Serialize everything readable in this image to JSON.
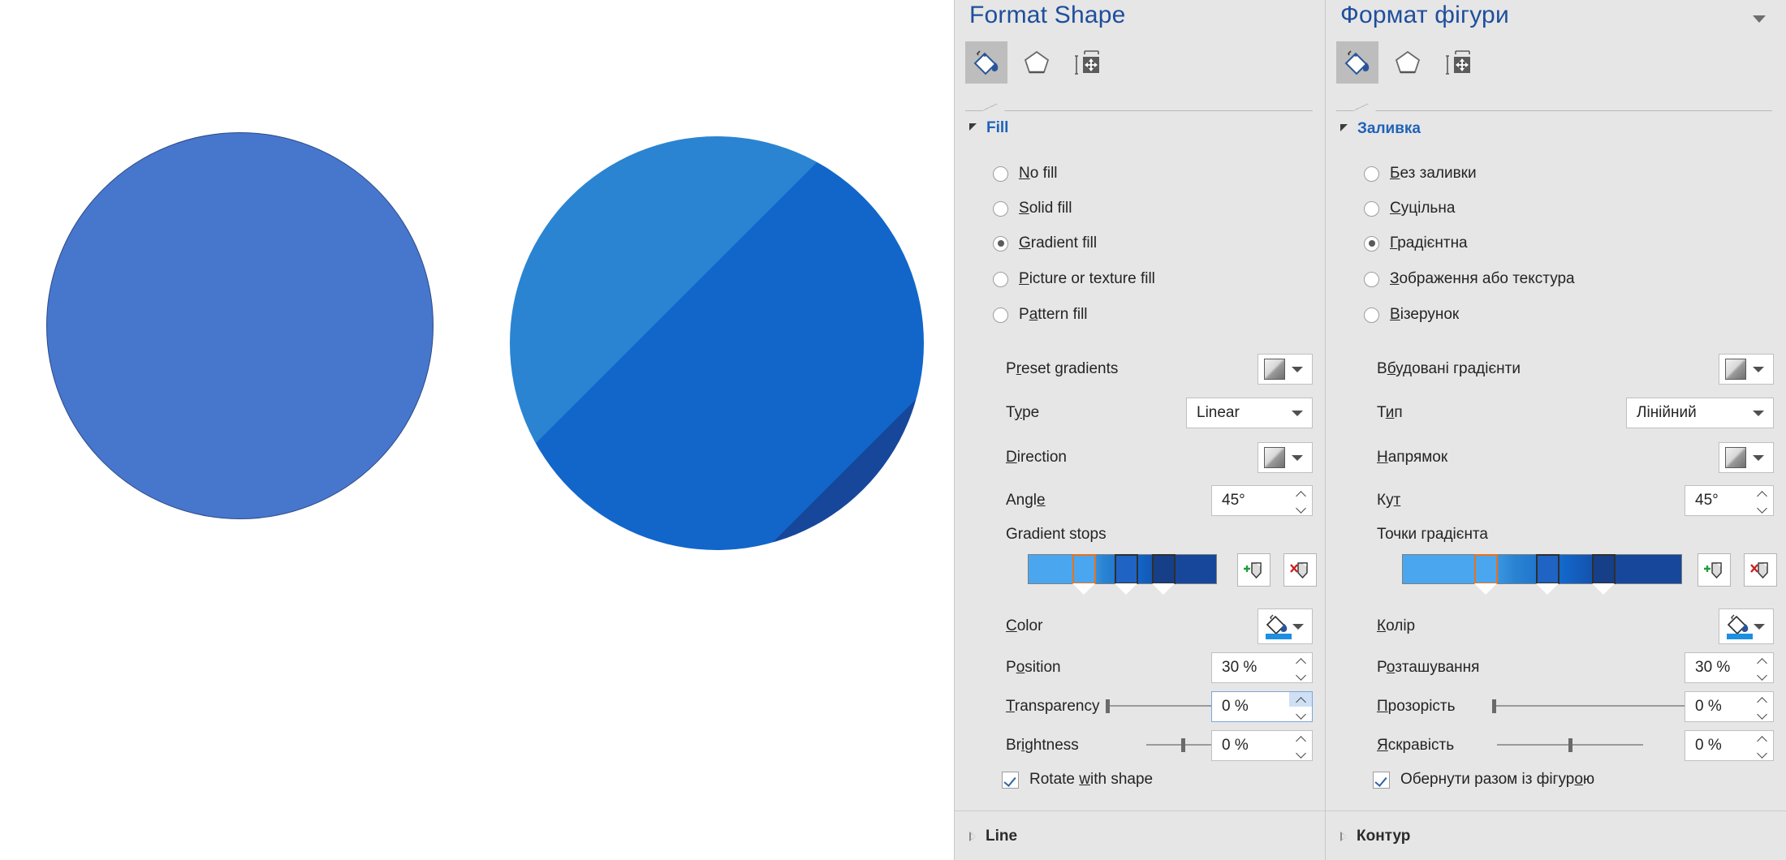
{
  "canvas": {
    "shapes": [
      {
        "name": "solid-blue-circle",
        "fill": "#4776cd",
        "outline": "#2b4a87"
      },
      {
        "name": "gradient-blue-circle",
        "angle": "45",
        "bands": [
          "#4aa7ef",
          "#2a84d2",
          "#1266ca",
          "#16479b"
        ]
      }
    ]
  },
  "panels": [
    {
      "id": "en",
      "title": "Format Shape",
      "tabs": [
        {
          "name": "fill-and-line",
          "icon": "paint-bucket-icon",
          "active": true
        },
        {
          "name": "effects",
          "icon": "pentagon-icon",
          "active": false
        },
        {
          "name": "size-and-properties",
          "icon": "size-properties-icon",
          "active": false
        }
      ],
      "fill_section": {
        "label": "Fill",
        "expanded": true,
        "options": [
          {
            "label": "No fill",
            "acc": "N",
            "rest": "o fill",
            "selected": false
          },
          {
            "label": "Solid fill",
            "acc": "S",
            "rest": "olid fill",
            "selected": false
          },
          {
            "label": "Gradient fill",
            "acc": "G",
            "rest": "radient fill",
            "selected": true
          },
          {
            "label": "Picture or texture fill",
            "acc": "P",
            "rest": "icture or texture fill",
            "selected": false
          },
          {
            "label": "Pattern fill",
            "pre": "P",
            "acc": "a",
            "rest": "ttern fill",
            "selected": false
          }
        ],
        "preset_gradients": {
          "label_pre": "P",
          "label_acc": "r",
          "label_rest": "eset gradients"
        },
        "type": {
          "label_pre": "T",
          "label_acc": "y",
          "label_rest": "pe",
          "value": "Linear"
        },
        "direction": {
          "label_acc": "D",
          "label_rest": "irection"
        },
        "angle": {
          "label_pre": "Angl",
          "label_acc": "e",
          "label_rest": "",
          "value": "45°"
        },
        "gradient_stops": {
          "label": "Gradient stops"
        },
        "add_stop": {
          "name": "add-gradient-stop-button"
        },
        "remove_stop": {
          "name": "remove-gradient-stop-button"
        },
        "color": {
          "label_acc": "C",
          "label_rest": "olor"
        },
        "position": {
          "label_pre": "P",
          "label_acc": "o",
          "label_rest": "sition",
          "value": "30 %"
        },
        "transparency": {
          "label_acc": "T",
          "label_rest": "ransparency",
          "value": "0 %",
          "slider_pct": 0,
          "focused": true
        },
        "brightness": {
          "label_pre": "Br",
          "label_acc": "i",
          "label_rest": "ghtness",
          "value": "0 %",
          "slider_pct": 50
        },
        "rotate_with_shape": {
          "pre": "Rotate ",
          "acc": "w",
          "rest": "ith shape",
          "checked": true
        }
      },
      "line_section": {
        "label": "Line",
        "expanded": false
      }
    },
    {
      "id": "uk",
      "title": "Формат фігури",
      "tabs": [
        {
          "name": "fill-and-line",
          "icon": "paint-bucket-icon",
          "active": true
        },
        {
          "name": "effects",
          "icon": "pentagon-icon",
          "active": false
        },
        {
          "name": "size-and-properties",
          "icon": "size-properties-icon",
          "active": false
        }
      ],
      "fill_section": {
        "label": "Заливка",
        "expanded": true,
        "options": [
          {
            "label": "Без заливки",
            "acc": "Б",
            "rest": "ез заливки",
            "selected": false
          },
          {
            "label": "Суцільна",
            "acc": "С",
            "rest": "уцільна",
            "selected": false
          },
          {
            "label": "Градієнтна",
            "acc": "Г",
            "rest": "радієнтна",
            "selected": true
          },
          {
            "label": "Зображення або текстура",
            "acc": "З",
            "rest": "ображення або текстура",
            "selected": false
          },
          {
            "label": "Візерунок",
            "acc": "В",
            "rest": "ізерунок",
            "selected": false
          }
        ],
        "preset_gradients": {
          "label_pre": "В",
          "label_acc": "б",
          "label_rest": "удовані градієнти"
        },
        "type": {
          "label_pre": "Т",
          "label_acc": "и",
          "label_rest": "п",
          "value": "Лінійний"
        },
        "direction": {
          "label_acc": "Н",
          "label_rest": "апрямок"
        },
        "angle": {
          "label_pre": "Ку",
          "label_acc": "т",
          "label_rest": "",
          "value": "45°"
        },
        "gradient_stops": {
          "label": "Точки градієнта"
        },
        "add_stop": {
          "name": "add-gradient-stop-button"
        },
        "remove_stop": {
          "name": "remove-gradient-stop-button"
        },
        "color": {
          "label_acc": "К",
          "label_rest": "олір"
        },
        "position": {
          "label_pre": "Р",
          "label_acc": "о",
          "label_rest": "зташування",
          "value": "30 %"
        },
        "transparency": {
          "label_acc": "П",
          "label_rest": "розорість",
          "value": "0 %",
          "slider_pct": 0,
          "focused": false
        },
        "brightness": {
          "label_acc": "Я",
          "label_rest": "скравість",
          "value": "0 %",
          "slider_pct": 50
        },
        "rotate_with_shape": {
          "pre": "Обернути разом із фігур",
          "acc": "о",
          "rest": "ю",
          "checked": true
        }
      },
      "line_section": {
        "label": "Контур",
        "expanded": false
      }
    }
  ],
  "gradient_stop_bar": {
    "bar_gradient_colors": [
      "#4aa7ef",
      "#2a84d2",
      "#1266ca",
      "#16479b"
    ],
    "stops": [
      {
        "position_pct": 30,
        "color": "#4aa7ef",
        "selected": true
      },
      {
        "position_pct": 52,
        "color": "#1f63c4",
        "selected": false
      },
      {
        "position_pct": 72,
        "color": "#163f88",
        "selected": false
      }
    ]
  }
}
